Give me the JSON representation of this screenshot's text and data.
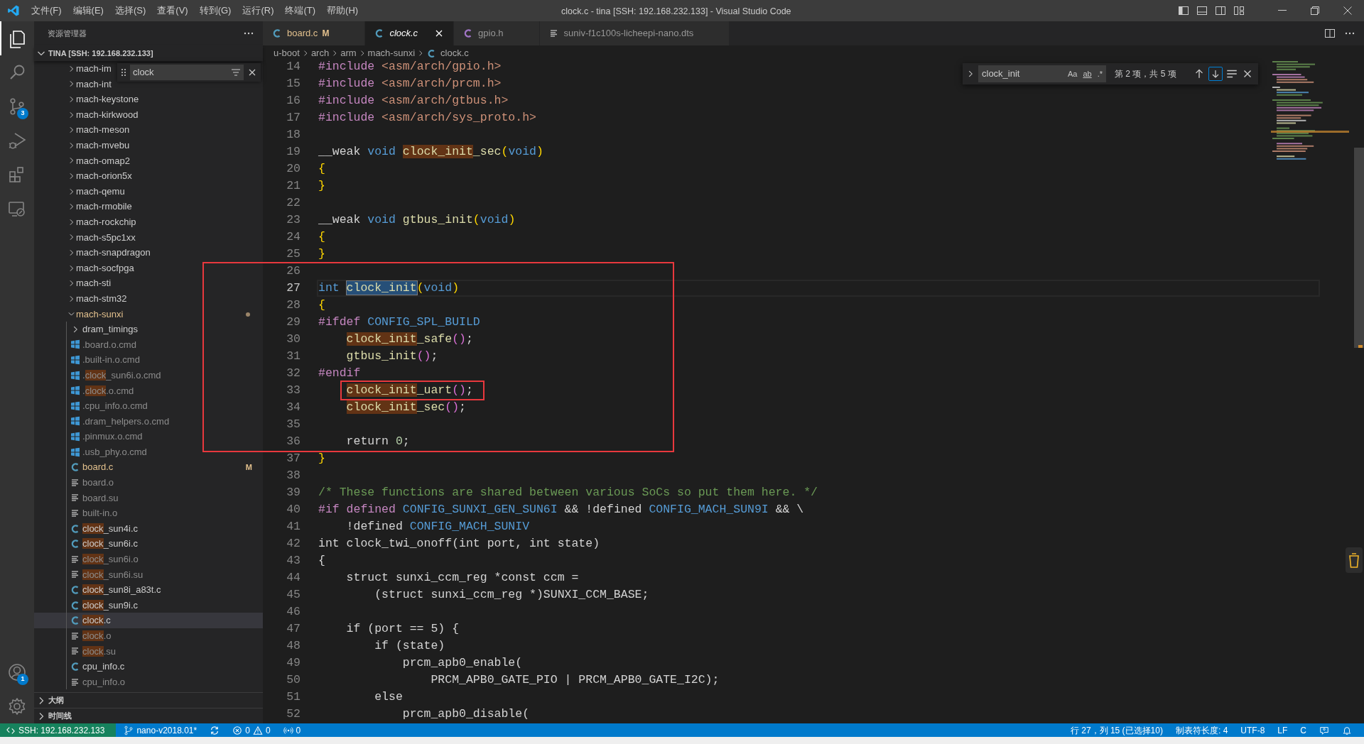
{
  "window": {
    "title": "clock.c - tina [SSH: 192.168.232.133] - Visual Studio Code"
  },
  "menu": [
    "文件(F)",
    "编辑(E)",
    "选择(S)",
    "查看(V)",
    "转到(G)",
    "运行(R)",
    "终端(T)",
    "帮助(H)"
  ],
  "activity_bar": {
    "items": [
      {
        "kind": "explorer",
        "selected": true
      },
      {
        "kind": "search",
        "selected": false
      },
      {
        "kind": "source_control",
        "selected": false,
        "badge": "3"
      },
      {
        "kind": "run",
        "selected": false
      },
      {
        "kind": "extensions",
        "selected": false
      },
      {
        "kind": "remote",
        "selected": false
      }
    ],
    "bottom": [
      {
        "kind": "accounts",
        "badge": "1"
      },
      {
        "kind": "settings"
      }
    ]
  },
  "sidebar": {
    "title": "资源管理器",
    "root": {
      "label": "TINA [SSH: 192.168.232.133]",
      "expanded": true
    },
    "filter": {
      "value": "clock"
    },
    "tree": [
      {
        "label": "mach-im",
        "kind": "folder",
        "expanded": false,
        "selected": false
      },
      {
        "label": "mach-int",
        "kind": "folder",
        "expanded": false,
        "selected": false
      },
      {
        "label": "mach-keystone",
        "kind": "folder",
        "expanded": false,
        "selected": false
      },
      {
        "label": "mach-kirkwood",
        "kind": "folder",
        "expanded": false,
        "selected": false
      },
      {
        "label": "mach-meson",
        "kind": "folder",
        "expanded": false,
        "selected": false
      },
      {
        "label": "mach-mvebu",
        "kind": "folder",
        "expanded": false,
        "selected": false
      },
      {
        "label": "mach-omap2",
        "kind": "folder",
        "expanded": false,
        "selected": false
      },
      {
        "label": "mach-orion5x",
        "kind": "folder",
        "expanded": false,
        "selected": false
      },
      {
        "label": "mach-qemu",
        "kind": "folder",
        "expanded": false,
        "selected": false
      },
      {
        "label": "mach-rmobile",
        "kind": "folder",
        "expanded": false,
        "selected": false
      },
      {
        "label": "mach-rockchip",
        "kind": "folder",
        "expanded": false,
        "selected": false
      },
      {
        "label": "mach-s5pc1xx",
        "kind": "folder",
        "expanded": false,
        "selected": false
      },
      {
        "label": "mach-snapdragon",
        "kind": "folder",
        "expanded": false,
        "selected": false
      },
      {
        "label": "mach-socfpga",
        "kind": "folder",
        "expanded": false,
        "selected": false
      },
      {
        "label": "mach-sti",
        "kind": "folder",
        "expanded": false,
        "selected": false
      },
      {
        "label": "mach-stm32",
        "kind": "folder",
        "expanded": false,
        "selected": false
      },
      {
        "label": "mach-sunxi",
        "kind": "folder",
        "expanded": true,
        "selected": false,
        "modified": true,
        "children": [
          {
            "label": "dram_timings",
            "kind": "folder",
            "expanded": false,
            "selected": false
          },
          {
            "label": ".board.o.cmd",
            "kind": "cmd",
            "ignored": true,
            "selected": false
          },
          {
            "label": ".built-in.o.cmd",
            "kind": "cmd",
            "ignored": true,
            "selected": false
          },
          {
            "segments": [
              {
                "text": ".",
                "match": false
              },
              {
                "text": "clock",
                "match": true
              },
              {
                "text": "_sun6i.o.cmd",
                "match": false
              }
            ],
            "kind": "cmd",
            "ignored": true,
            "selected": false
          },
          {
            "segments": [
              {
                "text": ".",
                "match": false
              },
              {
                "text": "clock",
                "match": true
              },
              {
                "text": ".o.cmd",
                "match": false
              }
            ],
            "kind": "cmd",
            "ignored": true,
            "selected": false
          },
          {
            "label": ".cpu_info.o.cmd",
            "kind": "cmd",
            "ignored": true,
            "selected": false
          },
          {
            "label": ".dram_helpers.o.cmd",
            "kind": "cmd",
            "ignored": true,
            "selected": false
          },
          {
            "label": ".pinmux.o.cmd",
            "kind": "cmd",
            "ignored": true,
            "selected": false
          },
          {
            "label": ".usb_phy.o.cmd",
            "kind": "cmd",
            "ignored": true,
            "selected": false
          },
          {
            "label": "board.c",
            "kind": "c",
            "ignored": false,
            "selected": false,
            "modified": true,
            "badge": "M"
          },
          {
            "label": "board.o",
            "kind": "text",
            "ignored": true,
            "selected": false
          },
          {
            "label": "board.su",
            "kind": "text",
            "ignored": true,
            "selected": false
          },
          {
            "label": "built-in.o",
            "kind": "text",
            "ignored": true,
            "selected": false
          },
          {
            "segments": [
              {
                "text": "clock",
                "match": true
              },
              {
                "text": "_sun4i.c",
                "match": false
              }
            ],
            "kind": "c",
            "ignored": false,
            "selected": false
          },
          {
            "segments": [
              {
                "text": "clock",
                "match": true
              },
              {
                "text": "_sun6i.c",
                "match": false
              }
            ],
            "kind": "c",
            "ignored": false,
            "selected": false
          },
          {
            "segments": [
              {
                "text": "clock",
                "match": true
              },
              {
                "text": "_sun6i.o",
                "match": false
              }
            ],
            "kind": "text",
            "ignored": true,
            "selected": false
          },
          {
            "segments": [
              {
                "text": "clock",
                "match": true
              },
              {
                "text": "_sun6i.su",
                "match": false
              }
            ],
            "kind": "text",
            "ignored": true,
            "selected": false
          },
          {
            "segments": [
              {
                "text": "clock",
                "match": true
              },
              {
                "text": "_sun8i_a83t.c",
                "match": false
              }
            ],
            "kind": "c",
            "ignored": false,
            "selected": false
          },
          {
            "segments": [
              {
                "text": "clock",
                "match": true
              },
              {
                "text": "_sun9i.c",
                "match": false
              }
            ],
            "kind": "c",
            "ignored": false,
            "selected": false
          },
          {
            "segments": [
              {
                "text": "clock",
                "match": true
              },
              {
                "text": ".c",
                "match": false
              }
            ],
            "kind": "c",
            "ignored": false,
            "selected": true
          },
          {
            "segments": [
              {
                "text": "clock",
                "match": true
              },
              {
                "text": ".o",
                "match": false
              }
            ],
            "kind": "text",
            "ignored": true,
            "selected": false
          },
          {
            "segments": [
              {
                "text": "clock",
                "match": true
              },
              {
                "text": ".su",
                "match": false
              }
            ],
            "kind": "text",
            "ignored": true,
            "selected": false
          },
          {
            "label": "cpu_info.c",
            "kind": "c",
            "ignored": false,
            "selected": false
          },
          {
            "label": "cpu_info.o",
            "kind": "text",
            "ignored": true,
            "selected": false
          }
        ]
      }
    ],
    "panels": [
      {
        "label": "大纲",
        "expanded": false
      },
      {
        "label": "时间线",
        "expanded": false
      }
    ]
  },
  "tabs": [
    {
      "label": "board.c",
      "kind": "c",
      "selected": false,
      "preview": false,
      "modified": true,
      "badge": "M"
    },
    {
      "label": "clock.c",
      "kind": "c",
      "selected": true,
      "preview": true,
      "modified": false
    },
    {
      "label": "gpio.h",
      "kind": "h",
      "selected": false,
      "preview": false,
      "modified": false
    },
    {
      "label": "suniv-f1c100s-licheepi-nano.dts",
      "kind": "text",
      "selected": false,
      "preview": false,
      "modified": false
    }
  ],
  "breadcrumb": [
    {
      "label": "u-boot",
      "kind": "folder"
    },
    {
      "label": "arch",
      "kind": "folder"
    },
    {
      "label": "arm",
      "kind": "folder"
    },
    {
      "label": "mach-sunxi",
      "kind": "folder"
    },
    {
      "label": "clock.c",
      "kind": "c"
    }
  ],
  "find": {
    "value": "clock_init",
    "toggles": [
      {
        "label": "Aa",
        "on": false
      },
      {
        "label": "ab",
        "on": false
      },
      {
        "label": ".*",
        "on": false
      }
    ],
    "result": "第 2 项，共 5 项"
  },
  "code": [
    {
      "number": "14",
      "tokens": [
        {
          "text": "#include",
          "kind": "preproc"
        },
        {
          "text": " <asm/arch/gpio.h>",
          "kind": "string"
        }
      ]
    },
    {
      "number": "15",
      "tokens": [
        {
          "text": "#include",
          "kind": "preproc"
        },
        {
          "text": " <asm/arch/prcm.h>",
          "kind": "string"
        }
      ]
    },
    {
      "number": "16",
      "tokens": [
        {
          "text": "#include",
          "kind": "preproc"
        },
        {
          "text": " <asm/arch/gtbus.h>",
          "kind": "string"
        }
      ]
    },
    {
      "number": "17",
      "tokens": [
        {
          "text": "#include",
          "kind": "preproc"
        },
        {
          "text": " <asm/arch/sys_proto.h>",
          "kind": "string"
        }
      ]
    },
    {
      "number": "18"
    },
    {
      "number": "19",
      "tokens": [
        {
          "text": "__weak ",
          "kind": "plain"
        },
        {
          "text": "void ",
          "kind": "keyword"
        },
        {
          "text": "clock_init",
          "kind": "function",
          "match": true
        },
        {
          "text": "_sec",
          "kind": "function"
        },
        {
          "text": "(",
          "kind": "bracket1"
        },
        {
          "text": "void",
          "kind": "keyword"
        },
        {
          "text": ")",
          "kind": "bracket1"
        }
      ]
    },
    {
      "number": "20",
      "tokens": [
        {
          "text": "{",
          "kind": "bracket1"
        }
      ]
    },
    {
      "number": "21",
      "tokens": [
        {
          "text": "}",
          "kind": "bracket1"
        }
      ]
    },
    {
      "number": "22"
    },
    {
      "number": "23",
      "tokens": [
        {
          "text": "__weak ",
          "kind": "plain"
        },
        {
          "text": "void ",
          "kind": "keyword"
        },
        {
          "text": "gtbus_init",
          "kind": "function"
        },
        {
          "text": "(",
          "kind": "bracket1"
        },
        {
          "text": "void",
          "kind": "keyword"
        },
        {
          "text": ")",
          "kind": "bracket1"
        }
      ]
    },
    {
      "number": "24",
      "tokens": [
        {
          "text": "{",
          "kind": "bracket1"
        }
      ]
    },
    {
      "number": "25",
      "tokens": [
        {
          "text": "}",
          "kind": "bracket1"
        }
      ]
    },
    {
      "number": "26"
    },
    {
      "number": "27",
      "current": true,
      "tokens": [
        {
          "text": "int ",
          "kind": "keyword"
        },
        {
          "text": "clock_init",
          "kind": "function",
          "match": true,
          "current": true
        },
        {
          "text": "(",
          "kind": "bracket1"
        },
        {
          "text": "void",
          "kind": "keyword"
        },
        {
          "text": ")",
          "kind": "bracket1"
        }
      ]
    },
    {
      "number": "28",
      "tokens": [
        {
          "text": "{",
          "kind": "bracket1"
        }
      ]
    },
    {
      "number": "29",
      "tokens": [
        {
          "text": "#ifdef ",
          "kind": "preproc"
        },
        {
          "text": "CONFIG_SPL_BUILD",
          "kind": "keyword"
        }
      ]
    },
    {
      "number": "30",
      "indented": true,
      "tokens": [
        {
          "text": "clock_init",
          "kind": "function",
          "match": true
        },
        {
          "text": "_safe",
          "kind": "function"
        },
        {
          "text": "()",
          "kind": "bracket2"
        },
        {
          "text": ";",
          "kind": "plain"
        }
      ]
    },
    {
      "number": "31",
      "tokens": [
        {
          "text": "    gtbus_init",
          "kind": "function"
        },
        {
          "text": "()",
          "kind": "bracket2"
        },
        {
          "text": ";",
          "kind": "plain"
        }
      ]
    },
    {
      "number": "32",
      "tokens": [
        {
          "text": "#endif",
          "kind": "preproc"
        }
      ]
    },
    {
      "number": "33",
      "indented": true,
      "tokens": [
        {
          "text": "clock_init",
          "kind": "function",
          "match": true
        },
        {
          "text": "_uart",
          "kind": "function"
        },
        {
          "text": "()",
          "kind": "bracket2"
        },
        {
          "text": ";",
          "kind": "plain"
        }
      ]
    },
    {
      "number": "34",
      "indented": true,
      "tokens": [
        {
          "text": "clock_init",
          "kind": "function",
          "match": true
        },
        {
          "text": "_sec",
          "kind": "function"
        },
        {
          "text": "()",
          "kind": "bracket2"
        },
        {
          "text": ";",
          "kind": "plain"
        }
      ]
    },
    {
      "number": "35"
    },
    {
      "number": "36",
      "tokens": [
        {
          "text": "    return ",
          "kind": "plain"
        },
        {
          "text": "0",
          "kind": "number"
        },
        {
          "text": ";",
          "kind": "plain"
        }
      ]
    },
    {
      "number": "37",
      "tokens": [
        {
          "text": "}",
          "kind": "bracket1"
        }
      ]
    },
    {
      "number": "38"
    },
    {
      "number": "39",
      "tokens": [
        {
          "text": "/* These functions are shared between various SoCs so put them here. */",
          "kind": "comment"
        }
      ]
    },
    {
      "number": "40",
      "tokens": [
        {
          "text": "#if defined ",
          "kind": "preproc"
        },
        {
          "text": "CONFIG_SUNXI_GEN_SUN6I",
          "kind": "keyword"
        },
        {
          "text": " && !defined ",
          "kind": "plain"
        },
        {
          "text": "CONFIG_MACH_SUN9I",
          "kind": "keyword"
        },
        {
          "text": " && \\",
          "kind": "plain"
        }
      ]
    },
    {
      "number": "41",
      "tokens": [
        {
          "text": "    !defined ",
          "kind": "plain"
        },
        {
          "text": "CONFIG_MACH_SUNIV",
          "kind": "keyword"
        }
      ]
    },
    {
      "number": "42",
      "tokens": [
        {
          "text": "int clock_twi_onoff(int port, int state)",
          "kind": "plain"
        }
      ]
    },
    {
      "number": "43",
      "tokens": [
        {
          "text": "{",
          "kind": "plain"
        }
      ]
    },
    {
      "number": "44",
      "tokens": [
        {
          "text": "    struct sunxi_ccm_reg *const ccm =",
          "kind": "plain"
        }
      ]
    },
    {
      "number": "45",
      "tokens": [
        {
          "text": "        (struct sunxi_ccm_reg *)SUNXI_CCM_BASE;",
          "kind": "plain"
        }
      ]
    },
    {
      "number": "46"
    },
    {
      "number": "47",
      "tokens": [
        {
          "text": "    if (port == 5) {",
          "kind": "plain"
        }
      ]
    },
    {
      "number": "48",
      "tokens": [
        {
          "text": "        if (state)",
          "kind": "plain"
        }
      ]
    },
    {
      "number": "49",
      "tokens": [
        {
          "text": "            prcm_apb0_enable(",
          "kind": "plain"
        }
      ]
    },
    {
      "number": "50",
      "tokens": [
        {
          "text": "                PRCM_APB0_GATE_PIO | PRCM_APB0_GATE_I2C);",
          "kind": "plain"
        }
      ]
    },
    {
      "number": "51",
      "tokens": [
        {
          "text": "        else",
          "kind": "plain"
        }
      ]
    },
    {
      "number": "52",
      "tokens": [
        {
          "text": "            prcm_apb0_disable(",
          "kind": "plain"
        }
      ]
    }
  ],
  "status_bar": {
    "left": [
      {
        "kind": "remote",
        "text": "SSH: 192.168.232.133"
      },
      {
        "kind": "branch",
        "text": "nano-v2018.01*"
      },
      {
        "kind": "sync"
      },
      {
        "kind": "problems",
        "errors": "0",
        "warnings": "0"
      },
      {
        "kind": "ports",
        "text": "0"
      }
    ],
    "right": [
      {
        "kind": "text",
        "text": "行 27，列 15 (已选择10)"
      },
      {
        "kind": "text",
        "text": "制表符长度: 4"
      },
      {
        "kind": "text",
        "text": "UTF-8"
      },
      {
        "kind": "text",
        "text": "LF"
      },
      {
        "kind": "text",
        "text": "C"
      },
      {
        "kind": "feedback"
      },
      {
        "kind": "bell"
      }
    ]
  }
}
